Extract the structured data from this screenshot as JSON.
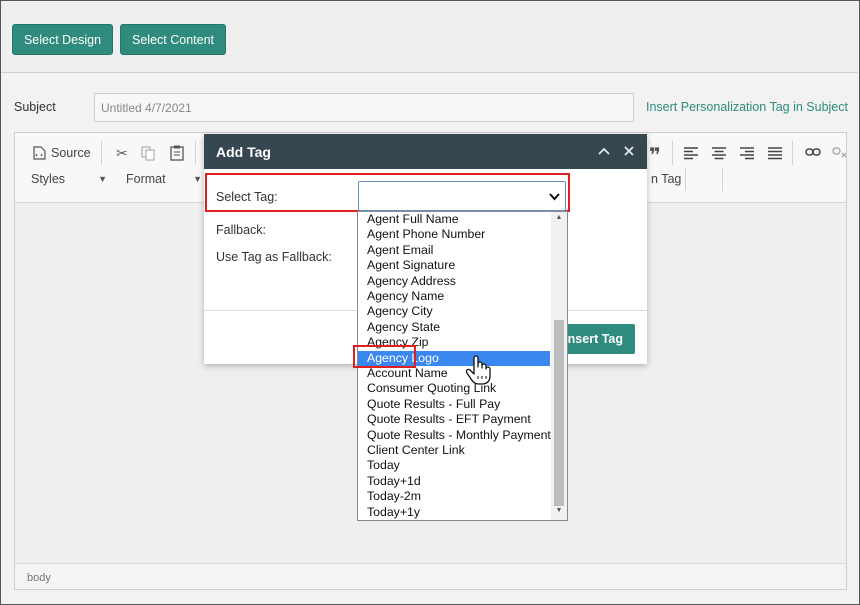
{
  "topbar": {
    "select_design": "Select Design",
    "select_content": "Select Content"
  },
  "subject": {
    "label": "Subject",
    "value": "Untitled 4/7/2021",
    "insert_link": "Insert Personalization Tag in Subject"
  },
  "toolbar": {
    "source": "Source",
    "styles": "Styles",
    "format": "Format",
    "tag_fragment": "n Tag",
    "icons": [
      "source-icon",
      "cut-icon",
      "copy-icon",
      "paste-icon",
      "blockquote-icon",
      "align-left-icon",
      "align-center-icon",
      "align-right-icon",
      "align-justify-icon",
      "link-icon",
      "unlink-icon"
    ]
  },
  "editor": {
    "status_path": "body"
  },
  "dialog": {
    "title": "Add Tag",
    "select_tag_label": "Select Tag:",
    "fallback_label": "Fallback:",
    "use_tag_fallback_label": "Use Tag as Fallback:",
    "insert_button": "Insert Tag",
    "select_value": ""
  },
  "dropdown": {
    "options": [
      "Agent Full Name",
      "Agent Phone Number",
      "Agent Email",
      "Agent Signature",
      "Agency Address",
      "Agency Name",
      "Agency City",
      "Agency State",
      "Agency Zip",
      "Agency Logo",
      "Account Name",
      "Consumer Quoting Link",
      "Quote Results - Full Pay",
      "Quote Results - EFT Payment",
      "Quote Results - Monthly Payment",
      "Client Center Link",
      "Today",
      "Today+1d",
      "Today-2m",
      "Today+1y"
    ],
    "highlighted": "Agency Logo"
  },
  "colors": {
    "accent": "#2e8b7e",
    "dialog_header": "#37474f",
    "selection": "#3a87f0",
    "annotation": "#e02020"
  }
}
